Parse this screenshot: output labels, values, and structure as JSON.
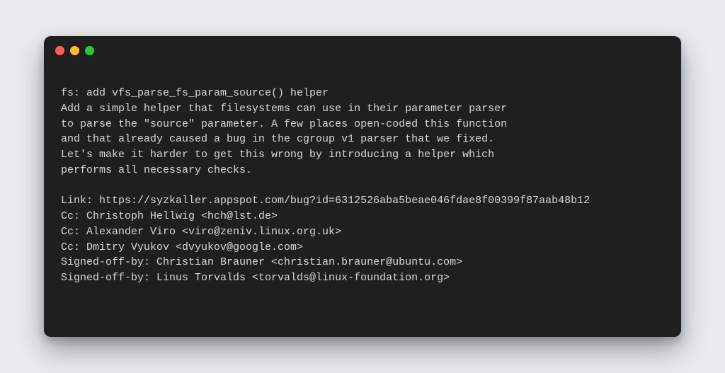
{
  "terminal": {
    "traffic_lights": [
      "red",
      "yellow",
      "green"
    ],
    "lines": [
      "fs: add vfs_parse_fs_param_source() helper",
      "Add a simple helper that filesystems can use in their parameter parser",
      "to parse the \"source\" parameter. A few places open-coded this function",
      "and that already caused a bug in the cgroup v1 parser that we fixed.",
      "Let's make it harder to get this wrong by introducing a helper which",
      "performs all necessary checks.",
      "",
      "Link: https://syzkaller.appspot.com/bug?id=6312526aba5beae046fdae8f00399f87aab48b12",
      "Cc: Christoph Hellwig <hch@lst.de>",
      "Cc: Alexander Viro <viro@zeniv.linux.org.uk>",
      "Cc: Dmitry Vyukov <dvyukov@google.com>",
      "Signed-off-by: Christian Brauner <christian.brauner@ubuntu.com>",
      "Signed-off-by: Linus Torvalds <torvalds@linux-foundation.org>"
    ]
  }
}
